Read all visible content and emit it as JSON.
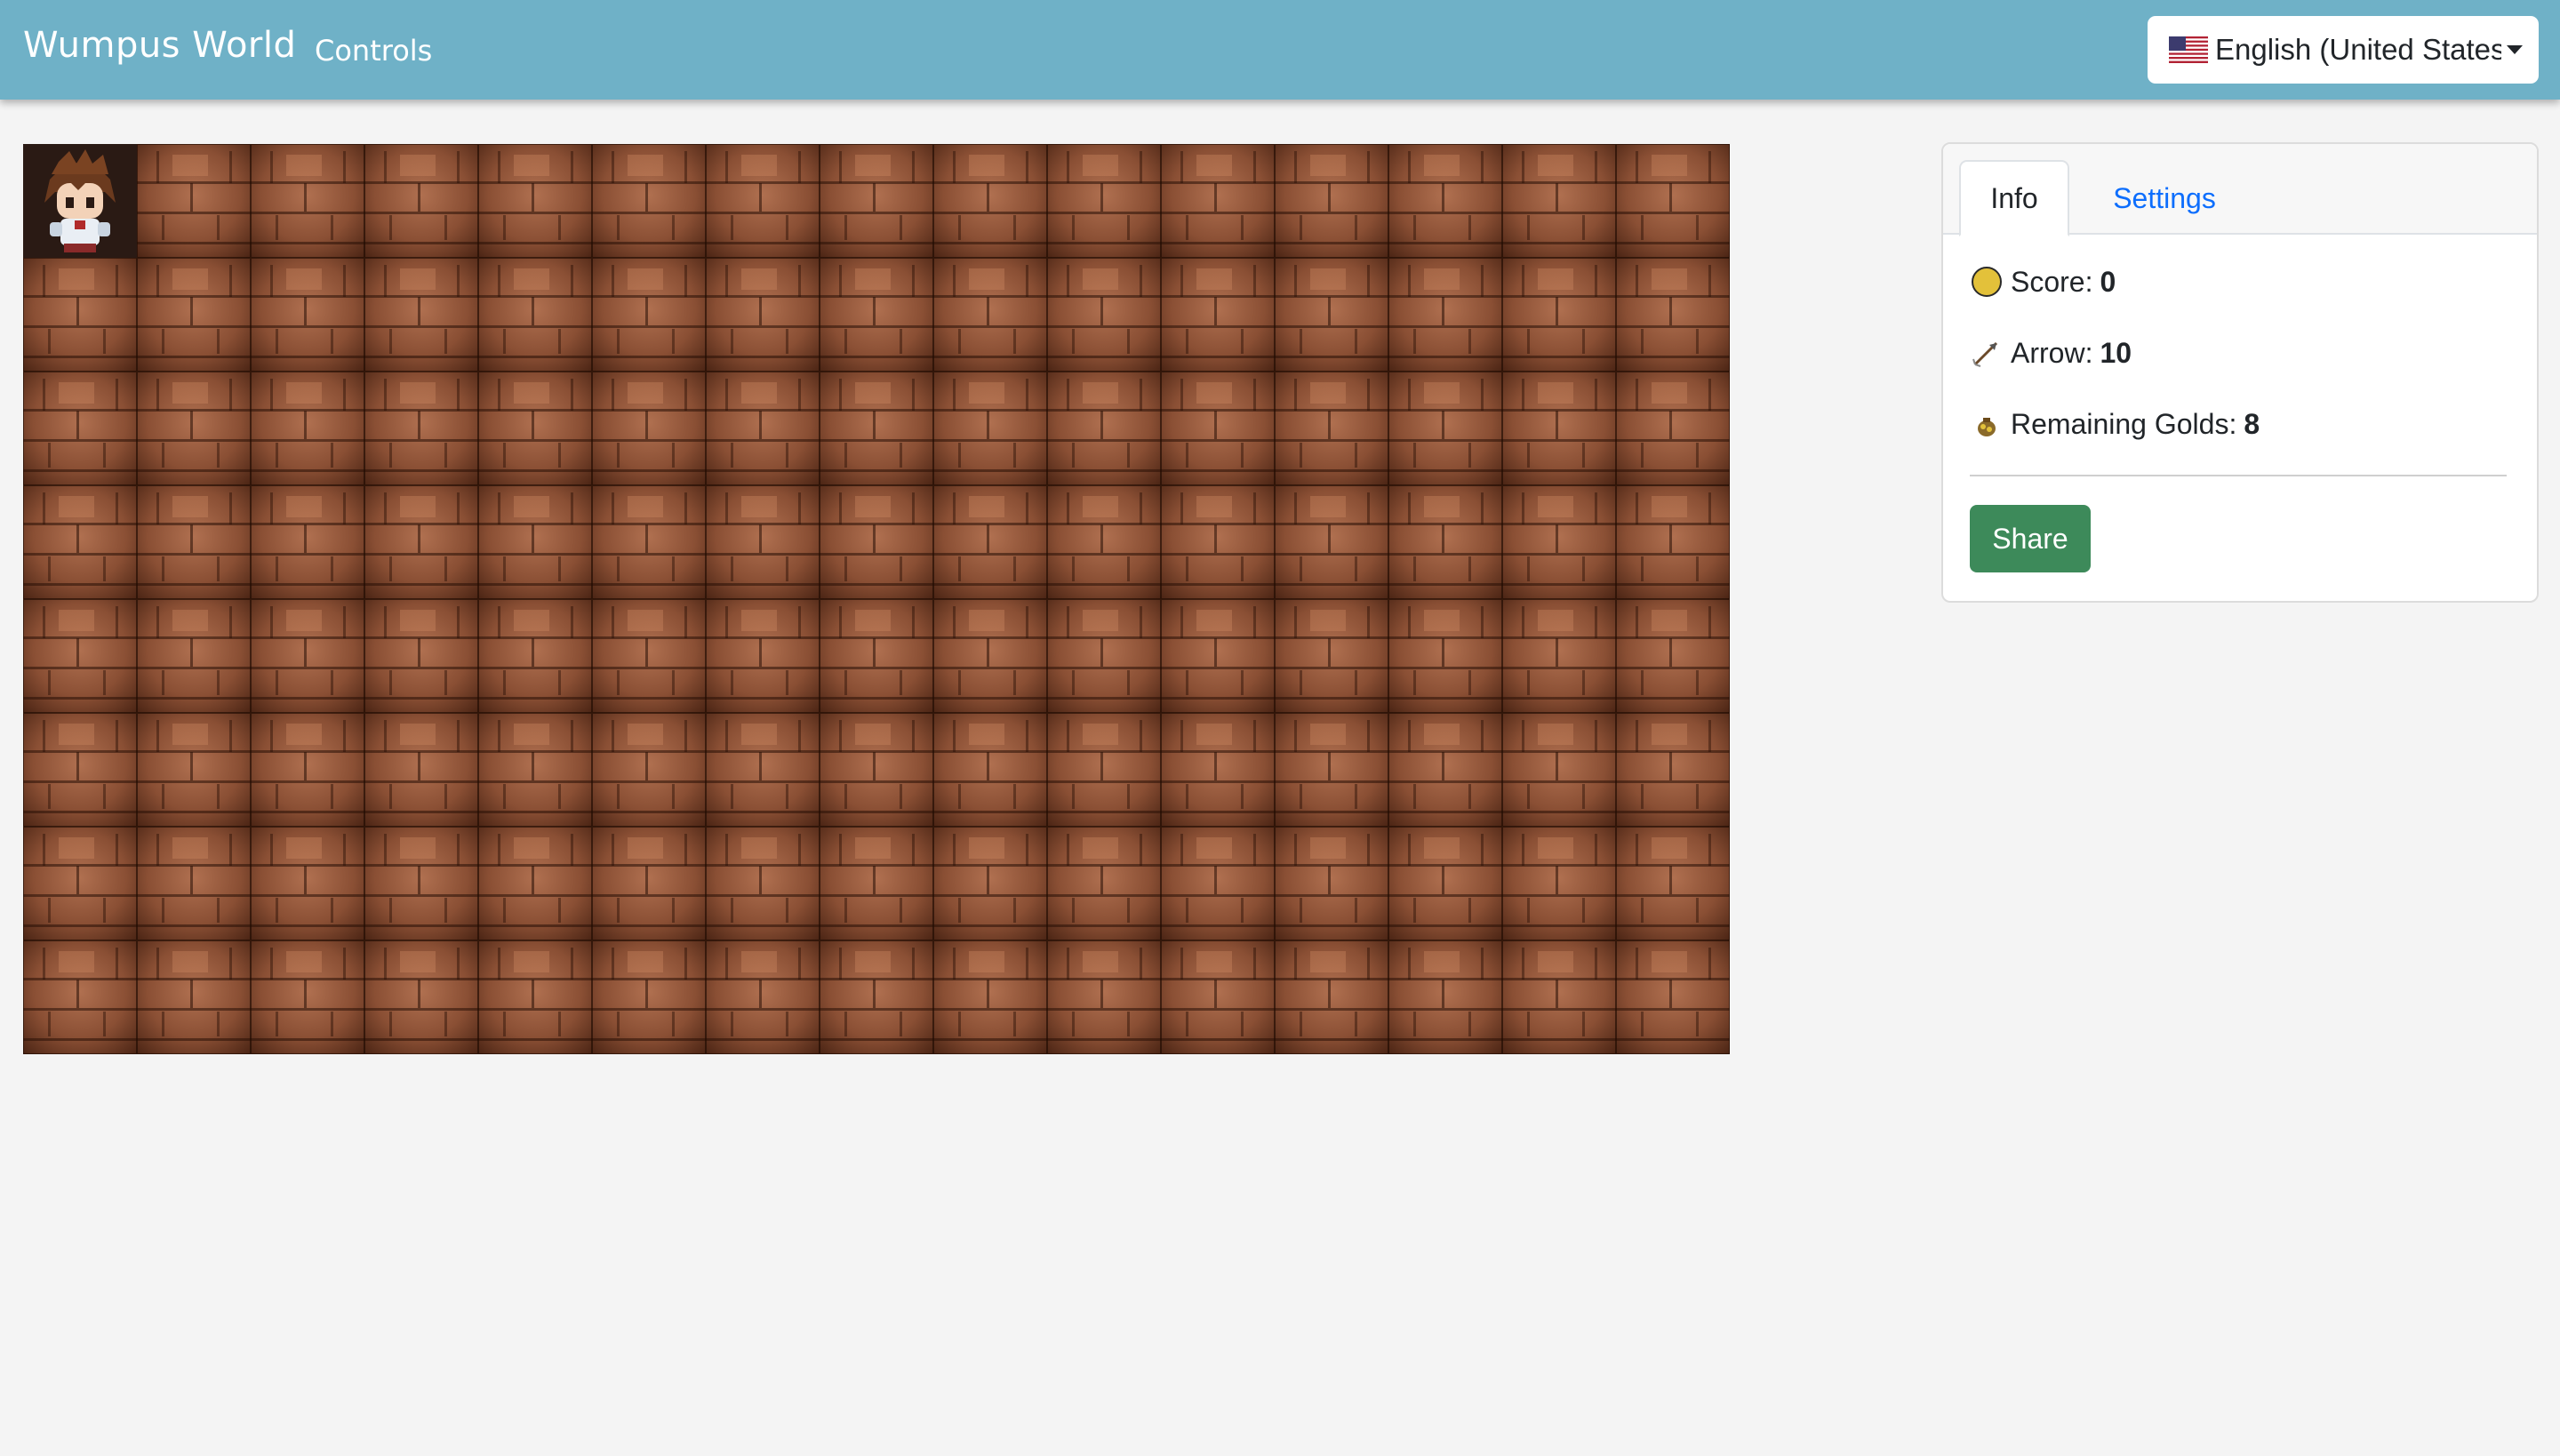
{
  "navbar": {
    "brand": "Wumpus World",
    "controls_label": "Controls",
    "language": {
      "flag_icon": "us-flag-icon",
      "label": "English (United States)"
    }
  },
  "board": {
    "columns": 15,
    "rows": 8,
    "player_position": {
      "row": 0,
      "col": 0
    },
    "hidden_tile": "brick-tile",
    "player_icon": "adventurer-icon"
  },
  "panel": {
    "tabs": [
      {
        "label": "Info",
        "active": true
      },
      {
        "label": "Settings",
        "active": false
      }
    ],
    "stats": {
      "score_label": "Score:",
      "score_value": "0",
      "score_icon": "coin-icon",
      "arrow_label": "Arrow:",
      "arrow_value": "10",
      "arrow_icon": "arrow-icon",
      "gold_label": "Remaining Golds:",
      "gold_value": "8",
      "gold_icon": "gold-bag-icon"
    },
    "share_label": "Share"
  },
  "colors": {
    "navbar": "#6fb1c7",
    "share_button": "#3d8a5a",
    "link": "#0d6efd",
    "page_background": "#f4f4f4"
  }
}
